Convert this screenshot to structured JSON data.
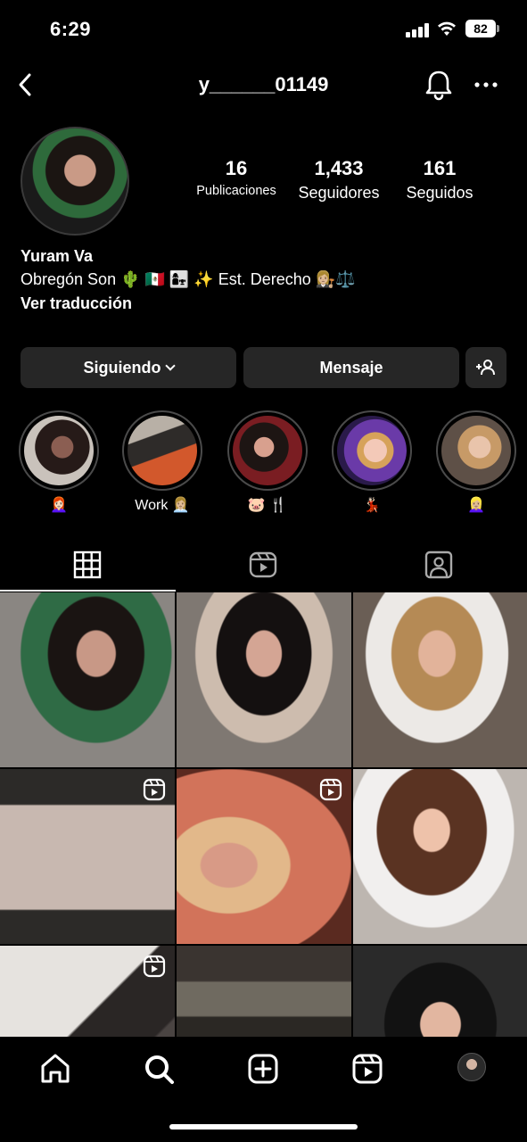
{
  "status_bar": {
    "time": "6:29",
    "battery": "82"
  },
  "header": {
    "username": "y______01149"
  },
  "profile": {
    "name": "Yuram Va",
    "bio": "Obregón Son 🌵 🇲🇽 👩‍👧 ✨ Est. Derecho 👩🏼‍⚖️⚖️",
    "translate": "Ver traducción"
  },
  "stats": [
    {
      "value": "16",
      "label": "Publicaciones"
    },
    {
      "value": "1,433",
      "label": "Seguidores"
    },
    {
      "value": "161",
      "label": "Seguidos"
    }
  ],
  "actions": {
    "follow_label": "Siguiendo",
    "message_label": "Mensaje"
  },
  "highlights": [
    {
      "label": "👩🏻‍🦰"
    },
    {
      "label": "Work 👩🏼‍💼"
    },
    {
      "label": "🐷 🍴"
    },
    {
      "label": "💃🏻"
    },
    {
      "label": "👱🏼‍♀️"
    }
  ],
  "tabs": [
    "grid-tab",
    "reels-tab",
    "tagged-tab"
  ],
  "posts": [
    {
      "type": "photo"
    },
    {
      "type": "photo"
    },
    {
      "type": "photo"
    },
    {
      "type": "reel"
    },
    {
      "type": "reel"
    },
    {
      "type": "photo"
    },
    {
      "type": "reel"
    },
    {
      "type": "photo"
    },
    {
      "type": "photo"
    }
  ],
  "nav": [
    "home-icon",
    "search-icon",
    "create-icon",
    "reels-icon",
    "profile-avatar"
  ]
}
